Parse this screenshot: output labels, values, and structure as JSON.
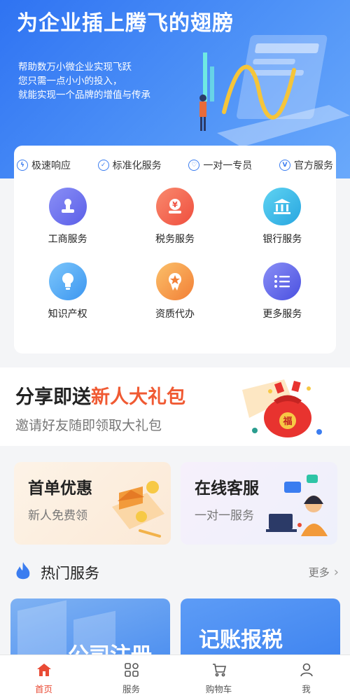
{
  "hero": {
    "title": "为企业插上腾飞的翅膀",
    "lines": [
      "帮助数万小微企业实现飞跃",
      "您只需一点小小的投入，",
      "就能实现一个品牌的增值与传承"
    ]
  },
  "features": [
    {
      "label": "极速响应",
      "icon": "lightning-icon"
    },
    {
      "label": "标准化服务",
      "icon": "check-icon"
    },
    {
      "label": "一对一专员",
      "icon": "heart-icon"
    },
    {
      "label": "官方服务",
      "icon": "v-badge-icon"
    }
  ],
  "services": [
    {
      "label": "工商服务",
      "icon": "stamp-icon",
      "color": "#6a6ef0"
    },
    {
      "label": "税务服务",
      "icon": "yen-hand-icon",
      "color": "#f2644f"
    },
    {
      "label": "银行服务",
      "icon": "bank-icon",
      "color": "#31b7e8"
    },
    {
      "label": "知识产权",
      "icon": "lightbulb-icon",
      "color": "#4aa6f3"
    },
    {
      "label": "资质代办",
      "icon": "award-icon",
      "color": "#f29a3a"
    },
    {
      "label": "更多服务",
      "icon": "list-icon",
      "color": "#5c63e6"
    }
  ],
  "share": {
    "prefix": "分享即送",
    "highlight": "新人大礼包",
    "subtitle": "邀请好友随即领取大礼包",
    "bag_text": "福"
  },
  "promos": [
    {
      "title": "首单优惠",
      "subtitle": "新人免费领"
    },
    {
      "title": "在线客服",
      "subtitle": "一对一服务"
    }
  ],
  "hot": {
    "title": "热门服务",
    "more": "更多",
    "cards": [
      {
        "label": "公司注册"
      },
      {
        "label": "记账报税"
      }
    ]
  },
  "tabbar": [
    {
      "label": "首页",
      "icon": "home-icon",
      "active": true
    },
    {
      "label": "服务",
      "icon": "grid-icon",
      "active": false
    },
    {
      "label": "购物车",
      "icon": "cart-icon",
      "active": false
    },
    {
      "label": "我",
      "icon": "user-icon",
      "active": false
    }
  ],
  "colors": {
    "primary": "#3b7df0",
    "accent": "#f05a33",
    "tab_active": "#e94b35"
  }
}
